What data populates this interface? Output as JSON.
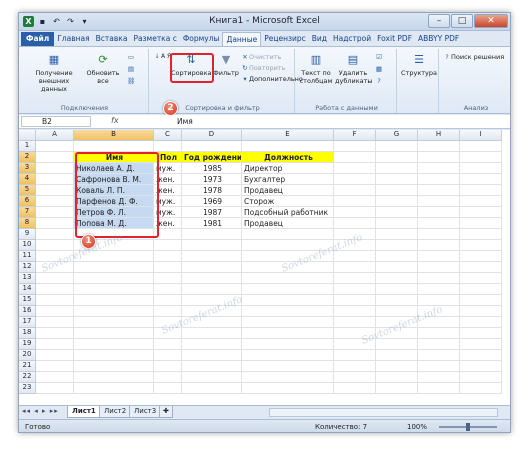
{
  "window": {
    "title": "Книга1 - Microsoft Excel",
    "controls": {
      "minimize": "–",
      "maximize": "□",
      "close": "✕"
    }
  },
  "ribbon_tabs": [
    "Файл",
    "Главная",
    "Вставка",
    "Разметка с",
    "Формулы",
    "Данные",
    "Рецензирс",
    "Вид",
    "Надстрой",
    "Foxit PDF",
    "ABBYY PDF"
  ],
  "ribbon": {
    "get_external": "Получение внешних данных",
    "refresh_all": "Обновить все",
    "group_connections": "Подключения",
    "sort_az": "А Я",
    "sort": "Сортировка",
    "filter": "Фильтр",
    "clear": "Очистить",
    "reapply": "Повторить",
    "advanced": "Дополнительно",
    "group_sort_filter": "Сортировка и фильтр",
    "text_to_columns": "Текст по столбцам",
    "remove_duplicates": "Удалить дубликаты",
    "group_data_tools": "Работа с данными",
    "outline": "Структура",
    "solver": "Поиск решения",
    "group_analysis": "Анализ"
  },
  "formula_bar": {
    "name_box": "B2",
    "fx": "fx",
    "value": "Имя"
  },
  "columns": [
    "A",
    "B",
    "C",
    "D",
    "E",
    "F",
    "G",
    "H",
    "I"
  ],
  "rows": [
    "1",
    "2",
    "3",
    "4",
    "5",
    "6",
    "7",
    "8",
    "9",
    "10",
    "11",
    "12",
    "13",
    "14",
    "15",
    "16",
    "17",
    "18",
    "19",
    "20",
    "21",
    "22",
    "23"
  ],
  "table": {
    "headers": [
      "Имя",
      "Пол",
      "Год рождения",
      "Должность"
    ],
    "data": [
      [
        "Николаев А. Д.",
        "муж.",
        "1985",
        "Директор"
      ],
      [
        "Сафронова В. М.",
        "жен.",
        "1973",
        "Бухгалтер"
      ],
      [
        "Коваль Л. П.",
        "жен.",
        "1978",
        "Продавец"
      ],
      [
        "Парфенов Д. Ф.",
        "муж.",
        "1969",
        "Сторож"
      ],
      [
        "Петров Ф. Л.",
        "муж.",
        "1987",
        "Подсобный работник"
      ],
      [
        "Попова М. Д.",
        "жен.",
        "1981",
        "Продавец"
      ]
    ]
  },
  "callouts": {
    "one": "1",
    "two": "2"
  },
  "sheets": [
    "Лист1",
    "Лист2",
    "Лист3"
  ],
  "status": {
    "ready": "Готово",
    "count": "Количество: 7",
    "zoom": "100%"
  },
  "watermark": "Sovtoreferat.info",
  "colors": {
    "highlight": "#e0242f",
    "header_fill": "#ffff00",
    "selection": "#c5d9f1"
  }
}
